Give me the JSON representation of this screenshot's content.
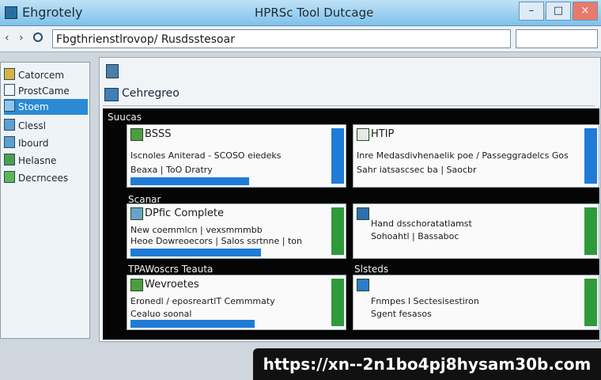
{
  "window": {
    "left_title": "Ehgrotely",
    "title": "HPRSc Tool Dutcage",
    "controls": [
      "–",
      "□",
      "×"
    ]
  },
  "addressbar": {
    "back": "‹",
    "forward": "›",
    "path": "Fbgthrienstlrovop/ Rusdsstesoar"
  },
  "sidebar": {
    "items": [
      {
        "label": "Catorcem",
        "selected": false
      },
      {
        "label": "ProstCame",
        "selected": false
      },
      {
        "label": "Stoem",
        "selected": true
      },
      {
        "label": "Clessl",
        "selected": false
      },
      {
        "label": "Ibourd",
        "selected": false
      },
      {
        "label": "Helasne",
        "selected": false
      },
      {
        "label": "Decrncees",
        "selected": false
      }
    ]
  },
  "main": {
    "heading": "Cehregreo",
    "panel_label": "Suucas",
    "section_labels": [
      "Scanar",
      "TPAWoscrs Teauta",
      "Slsteds"
    ],
    "cards": [
      {
        "title": "BSSS",
        "lines": [
          "Iscnoles Aniterad - SCOSO eiedeks",
          "Beaxa | ToO Dratry"
        ],
        "progress": 0.61
      },
      {
        "title": "HTIP",
        "lines": [
          "Inre Medasdivhenaelik poe / Passeggradelcs Gos",
          "Sahr iatsascsec ba | Saocbr"
        ],
        "progress": 0.0
      },
      {
        "title": "DPfic Complete",
        "lines": [
          "New coemmlcn | vexsmmmbb",
          "Heoe Dowreoecors | Salos ssrtnne | ton"
        ],
        "progress": 0.67
      },
      {
        "title": "",
        "lines": [
          "Hand dsschoratatlamst",
          "Sohoahtl | Bassaboc"
        ],
        "progress": 0.0
      },
      {
        "title": "Wevroetes",
        "lines": [
          "Eronedl / eposreartlT Cemmmaty",
          "Cealuo soonal"
        ],
        "progress": 0.64
      },
      {
        "title": "",
        "lines": [
          "Fnmpes l Sectesisestiron",
          "Sgent fesasos"
        ],
        "progress": 0.0
      }
    ]
  },
  "watermark": "https://xn--2n1bo4pj8hysam30b.com",
  "colors": {
    "titlebar": "#7fc2ea",
    "selection": "#2a8ad6",
    "progress": "#1f7bd6",
    "ok": "#2f9a3a",
    "panel": "#050505"
  }
}
